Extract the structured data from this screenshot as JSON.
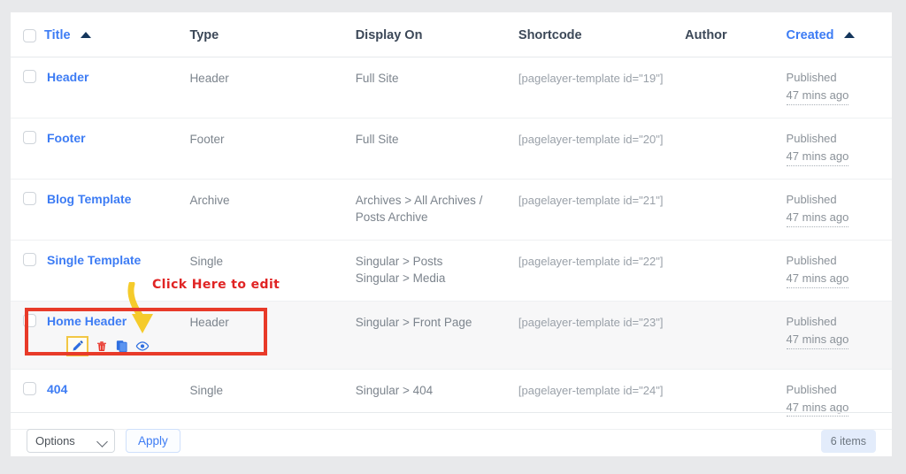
{
  "table": {
    "columns": [
      {
        "label": "Title",
        "sorted": true,
        "sort_dir": "asc"
      },
      {
        "label": "Type",
        "sorted": false
      },
      {
        "label": "Display On",
        "sorted": false
      },
      {
        "label": "Shortcode",
        "sorted": false
      },
      {
        "label": "Author",
        "sorted": false
      },
      {
        "label": "Created",
        "sorted": true,
        "sort_dir": "asc"
      }
    ],
    "rows": [
      {
        "title": "Header",
        "type": "Header",
        "display_on": "Full Site",
        "shortcode": "[pagelayer-template id=\"19\"]",
        "author": "",
        "status": "Published",
        "time": "47 mins ago"
      },
      {
        "title": "Footer",
        "type": "Footer",
        "display_on": "Full Site",
        "shortcode": "[pagelayer-template id=\"20\"]",
        "author": "",
        "status": "Published",
        "time": "47 mins ago"
      },
      {
        "title": "Blog Template",
        "type": "Archive",
        "display_on": "Archives > All Archives / Posts Archive",
        "shortcode": "[pagelayer-template id=\"21\"]",
        "author": "",
        "status": "Published",
        "time": "47 mins ago"
      },
      {
        "title": "Single Template",
        "type": "Single",
        "display_on": "Singular > Posts\nSingular > Media",
        "shortcode": "[pagelayer-template id=\"22\"]",
        "author": "",
        "status": "Published",
        "time": "47 mins ago"
      },
      {
        "title": "Home Header",
        "type": "Header",
        "display_on": "Singular > Front Page",
        "shortcode": "[pagelayer-template id=\"23\"]",
        "author": "",
        "status": "Published",
        "time": "47 mins ago"
      },
      {
        "title": "404",
        "type": "Single",
        "display_on": "Singular > 404",
        "shortcode": "[pagelayer-template id=\"24\"]",
        "author": "",
        "status": "Published",
        "time": "47 mins ago"
      }
    ],
    "row_actions": [
      {
        "name": "edit-icon",
        "title": "Edit"
      },
      {
        "name": "delete-icon",
        "title": "Delete"
      },
      {
        "name": "duplicate-icon",
        "title": "Duplicate"
      },
      {
        "name": "preview-icon",
        "title": "Preview"
      }
    ]
  },
  "annotation": {
    "text": "Click Here to edit",
    "text_color": "#e02424",
    "arrow_color": "#f5cb2b",
    "box_color": "#e83a29",
    "highlight_color": "#f2c744"
  },
  "footer": {
    "select_value": "Options",
    "apply_label": "Apply",
    "items_count": "6 items"
  },
  "colors": {
    "link": "#3d7cf4",
    "page_background": "#e8e9eb",
    "card_background": "#ffffff"
  }
}
